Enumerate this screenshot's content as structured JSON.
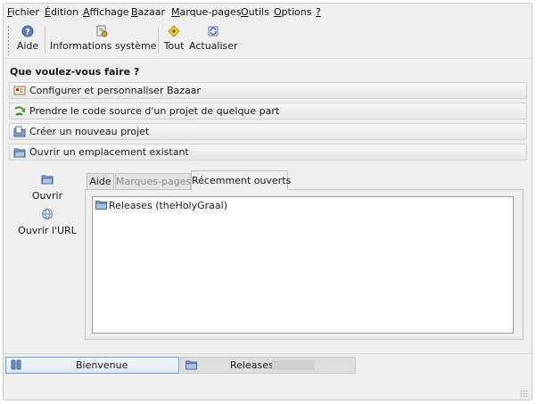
{
  "menu": [
    {
      "label": "Fichier",
      "key": "F",
      "rest": "ichier"
    },
    {
      "label": "Édition",
      "key": "É",
      "rest": "dition"
    },
    {
      "label": "Affichage",
      "key": "A",
      "rest": "ffichage"
    },
    {
      "label": "Bazaar",
      "key": "B",
      "rest": "azaar"
    },
    {
      "label": "Marque-pages",
      "key": "M",
      "rest": "arque-pages"
    },
    {
      "label": "Outils",
      "key": "O",
      "rest": "utils"
    },
    {
      "label": "Options",
      "key": "O",
      "rest": "ptions"
    },
    {
      "label": "?",
      "key": "?",
      "rest": ""
    }
  ],
  "toolbar": {
    "help_label": "Aide",
    "sysinfo_label": "Informations système",
    "all_label": "Tout",
    "refresh_label": "Actualiser"
  },
  "heading": "Que voulez-vous faire ?",
  "actions": [
    {
      "label": "Configurer et personnaliser Bazaar",
      "icon": "config-icon"
    },
    {
      "label": "Prendre le code source d'un projet de quelque part",
      "icon": "branch-icon"
    },
    {
      "label": "Créer un nouveau projet",
      "icon": "new-project-icon"
    },
    {
      "label": "Ouvrir un emplacement existant",
      "icon": "open-location-icon"
    }
  ],
  "side": {
    "open_label": "Ouvrir",
    "open_url_label": "Ouvrir l'URL"
  },
  "tabs": [
    {
      "label": "Aide",
      "state": "normal"
    },
    {
      "label": "Marques-pages",
      "state": "disabled"
    },
    {
      "label": "Récemment ouverts",
      "state": "active"
    }
  ],
  "recent": [
    {
      "label": "Releases (theHolyGraal)",
      "icon": "folder-icon"
    }
  ],
  "page_tabs": [
    {
      "label": "Bienvenue",
      "icon": "welcome-icon",
      "active": true
    },
    {
      "label": "Releases",
      "icon": "folder-icon",
      "active": false
    }
  ],
  "colors": {
    "accent_border": "#7d9ac4",
    "folder_blue": "#6e8fbf",
    "branch_green": "#3f9b2c"
  }
}
